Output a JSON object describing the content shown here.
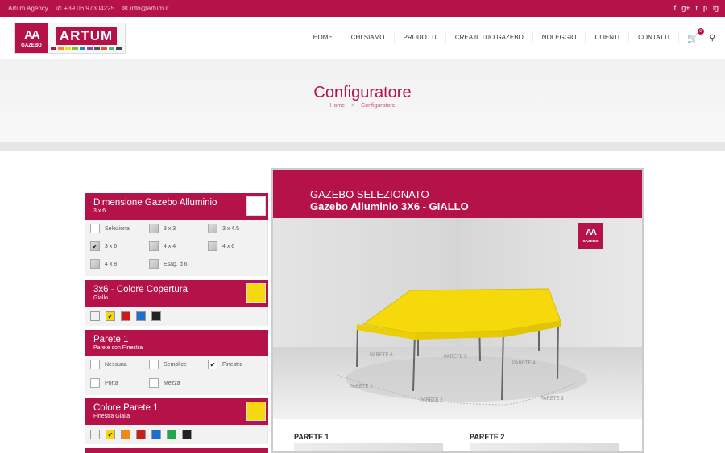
{
  "topbar": {
    "agency": "Artum Agency",
    "phone": "+39 06 97304225",
    "email": "info@artum.it",
    "social": [
      "f",
      "g+",
      "t",
      "p",
      "ig"
    ]
  },
  "logo": {
    "mark": "AA",
    "mark_sub": "GAZEBO",
    "name": "ARTUM",
    "swatch_colors": [
      "#b5124a",
      "#f08a24",
      "#f5d90a",
      "#7dbb42",
      "#1e88c7",
      "#8e44ad",
      "#555555",
      "#e74c3c",
      "#2ecc71",
      "#34495e"
    ]
  },
  "nav": {
    "items": [
      "HOME",
      "CHI SIAMO",
      "PRODOTTI",
      "CREA IL TUO GAZEBO",
      "NOLEGGIO",
      "CLIENTI",
      "CONTATTI"
    ],
    "cart_icon": "cart-icon",
    "cart_count": "0",
    "search_icon": "search-icon"
  },
  "hero": {
    "title": "Configuratore",
    "breadcrumb": [
      "Home",
      "Configuratore"
    ],
    "separator": ">"
  },
  "sections": {
    "dimension": {
      "title": "Dimensione Gazebo Alluminio",
      "subtitle": "3 x 6",
      "options": [
        "Seleziona",
        "3 x 3",
        "3 x 4.5",
        "3 x 6",
        "4 x 4",
        "4 x 6",
        "4 x 8",
        "Esag. d 6"
      ],
      "selected": "3 x 6"
    },
    "cover": {
      "title": "3x6 - Colore Copertura",
      "subtitle": "Giallo",
      "colors": [
        "#f0f0f0",
        "#f5d90a",
        "#cc1c1c",
        "#1e6fcc",
        "#222222"
      ],
      "selected_index": 1
    },
    "wall1": {
      "title": "Parete 1",
      "subtitle": "Parete con Finestra",
      "options": [
        "Nessuna",
        "Semplice",
        "Finestra",
        "Porta",
        "Mezza"
      ],
      "selected": "Finestra"
    },
    "wall1_color": {
      "title": "Colore Parete 1",
      "subtitle": "Finestra Gialla",
      "colors": [
        "#f0f0f0",
        "#f5d90a",
        "#f08a10",
        "#cc1c1c",
        "#1e6fcc",
        "#22a84a",
        "#222222"
      ],
      "selected_index": 1
    }
  },
  "preview": {
    "label": "GAZEBO SELEZIONATO",
    "product": "Gazebo Alluminio 3X6 - GIALLO",
    "canopy_color": "#f5d90a",
    "brand_color": "#b5124a",
    "wall_labels": [
      "PARETE 6",
      "PARETE 5",
      "PARETE 4",
      "PARETE 1",
      "PARETE 2",
      "PARETE 3"
    ],
    "walls_heading": [
      "PARETE 1",
      "PARETE 2"
    ]
  },
  "check": "✔"
}
